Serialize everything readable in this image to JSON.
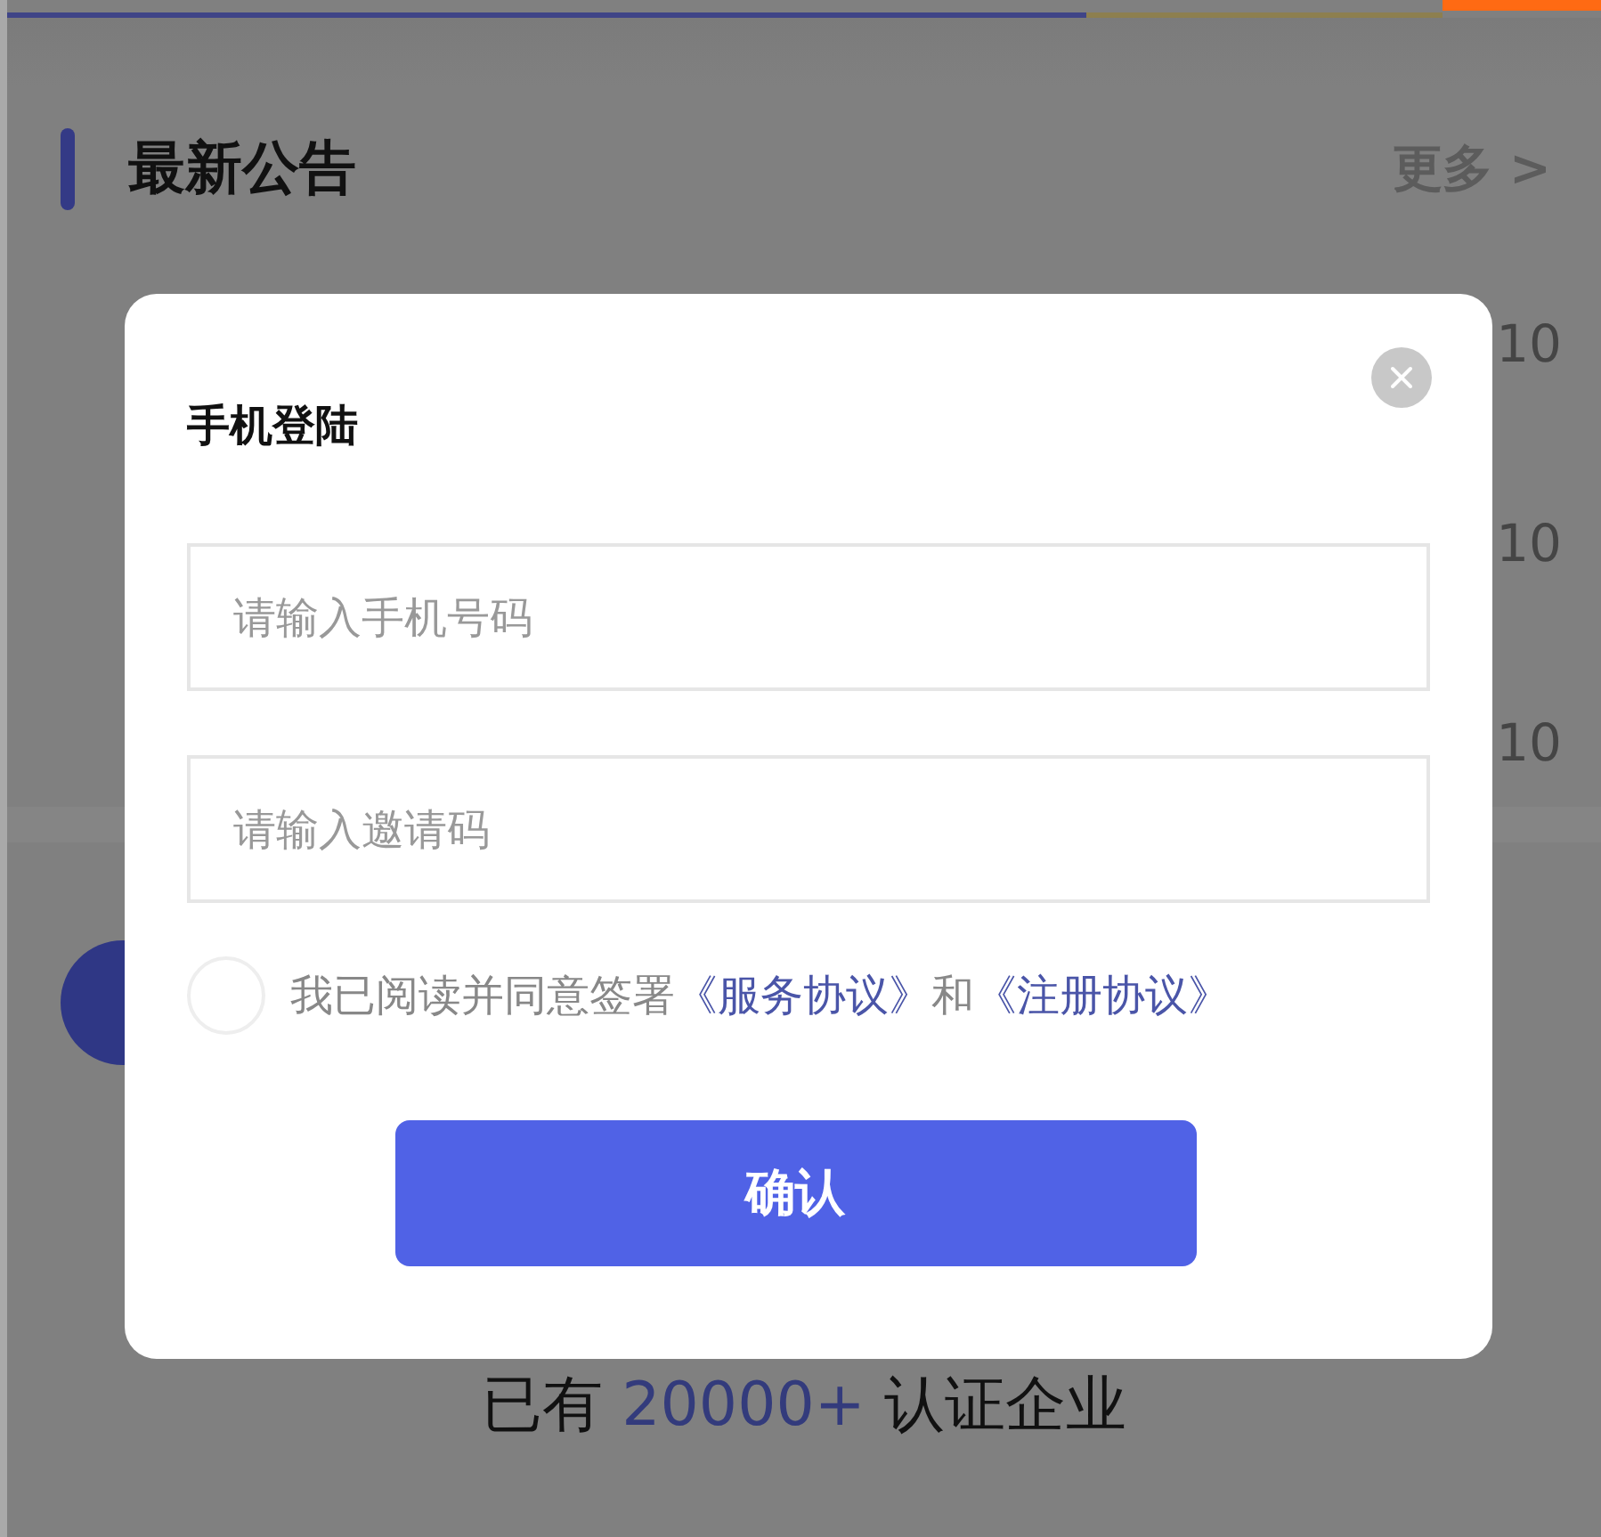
{
  "section": {
    "title": "最新公告",
    "more": "更多 >"
  },
  "notices": [
    {
      "date": "10"
    },
    {
      "date": "10"
    },
    {
      "date": "10"
    }
  ],
  "login_dialog": {
    "title": "手机登陆",
    "fields": [
      {
        "placeholder": "请输入手机号码"
      },
      {
        "placeholder": "请输入邀请码"
      }
    ],
    "agreement": {
      "checked": false,
      "parts": [
        {
          "kind": "text",
          "text": "我已阅读并同意签署"
        },
        {
          "kind": "link",
          "text": "《服务协议》"
        },
        {
          "kind": "text",
          "text": "和"
        },
        {
          "kind": "link",
          "text": "《注册协议》"
        }
      ]
    },
    "confirm": "确认"
  },
  "footer": {
    "prefix": "已有",
    "count": "20000+",
    "suffix": "认证企业"
  }
}
